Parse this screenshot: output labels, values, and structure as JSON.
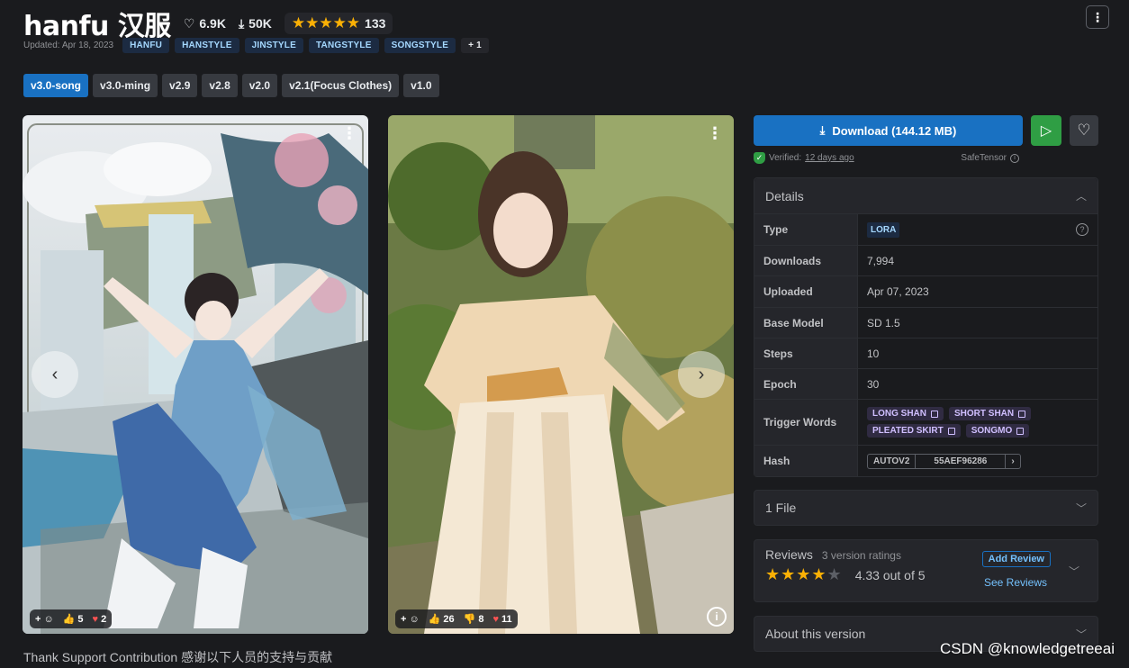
{
  "header": {
    "title": "hanfu 汉服",
    "likes": "6.9K",
    "downloads": "50K",
    "rating_stars": 5,
    "rating_count": "133"
  },
  "meta": {
    "updated": "Updated: Apr 18, 2023",
    "tags": [
      "HANFU",
      "HANSTYLE",
      "JINSTYLE",
      "TANGSTYLE",
      "SONGSTYLE"
    ],
    "more_tags": "+ 1"
  },
  "versions": [
    "v3.0-song",
    "v3.0-ming",
    "v2.9",
    "v2.8",
    "v2.0",
    "v2.1(Focus Clothes)",
    "v1.0"
  ],
  "gallery": {
    "image1": {
      "thumbs_up": "5",
      "hearts": "2"
    },
    "image2": {
      "thumbs_up": "26",
      "thumbs_down": "8",
      "hearts": "11"
    }
  },
  "description_preview": "Thank Support Contribution 感谢以下人员的支持与贡献",
  "sidebar": {
    "download_label": "Download (144.12 MB)",
    "verified_label": "Verified:",
    "verified_when": "12 days ago",
    "safetensor": "SafeTensor",
    "details_title": "Details",
    "details": {
      "type_label": "Type",
      "type_value": "LORA",
      "downloads_label": "Downloads",
      "downloads_value": "7,994",
      "uploaded_label": "Uploaded",
      "uploaded_value": "Apr 07, 2023",
      "base_label": "Base Model",
      "base_value": "SD 1.5",
      "steps_label": "Steps",
      "steps_value": "10",
      "epoch_label": "Epoch",
      "epoch_value": "30",
      "trigger_label": "Trigger Words",
      "trigger_words": [
        "LONG SHAN",
        "SHORT SHAN",
        "PLEATED SKIRT",
        "SONGMO"
      ],
      "hash_label": "Hash",
      "hash_type": "AUTOV2",
      "hash_value": "55AEF96286"
    },
    "files_label": "1 File",
    "reviews": {
      "title": "Reviews",
      "sub": "3 version ratings",
      "score": "4.33 out of 5",
      "stars_filled": 4,
      "add_review": "Add Review",
      "see_reviews": "See Reviews"
    },
    "about_label": "About this version"
  },
  "watermark": "CSDN @knowledgetreeai",
  "colors": {
    "accent": "#1971c2",
    "play": "#2f9e44",
    "star": "#fab005",
    "bg": "#1a1b1e"
  }
}
